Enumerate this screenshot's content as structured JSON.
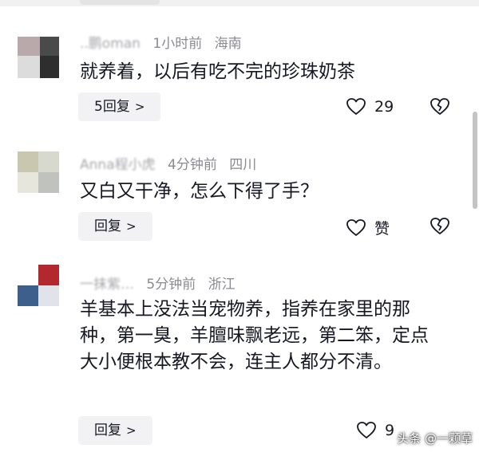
{
  "comments": [
    {
      "username": "..鹏oman",
      "time": "1小时前",
      "location": "海南",
      "text": "就养着，以后有吃不完的珍珠奶茶",
      "reply_label": "5回复",
      "likes": "29"
    },
    {
      "username": "Anna程小虎",
      "time": "4分钟前",
      "location": "四川",
      "text": "又白又干净，怎么下得了手？",
      "reply_label": "回复",
      "likes": "赞"
    },
    {
      "username": "一抹紫…",
      "time": "5分钟前",
      "location": "浙江",
      "text": "羊基本上没法当宠物养，指养在家里的那种，第一臭，羊膻味飘老远，第二笨，定点大小便根本教不会，连主人都分不清。",
      "reply_label": "回复",
      "likes": "9"
    }
  ],
  "watermark": "头条 @一颗草",
  "icons": {
    "like": "heart-outline-icon",
    "dislike": "broken-heart-icon",
    "reply_chevron": "chevron-right-icon"
  },
  "colors": {
    "text": "#161823",
    "meta": "#8a8b91",
    "button_bg": "#f2f2f4"
  }
}
